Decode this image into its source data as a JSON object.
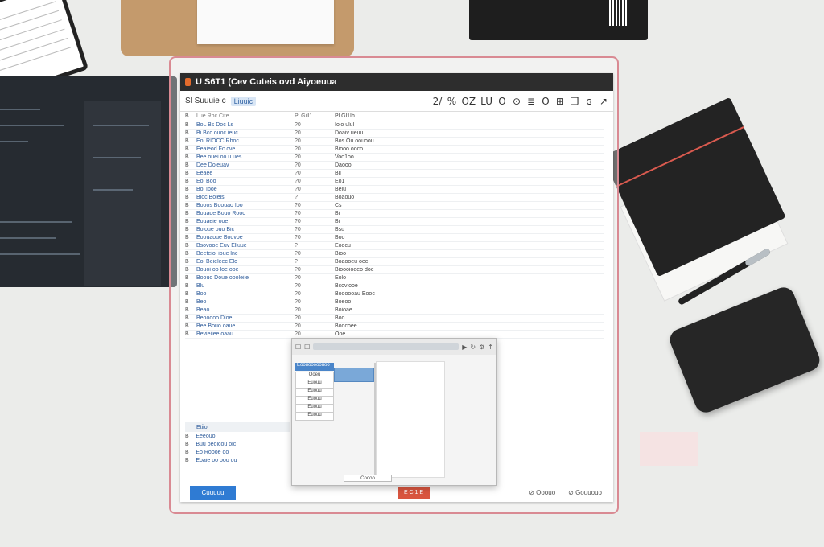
{
  "window": {
    "title": "U S6T1 (Cev Cuteis ovd Aiyoeuua",
    "toolbar": {
      "left_text": "Sl Suuuie c",
      "tag": "Liuuic",
      "icons": [
        "2/",
        "%",
        "OZ",
        "LU",
        "O",
        "⊙",
        "≣",
        "O",
        "⊞",
        "❒",
        "ɢ",
        "↗"
      ]
    },
    "table": {
      "headers": [
        "B",
        "Lue Rbc Cite",
        "Pl Gill1",
        "Pl Gl1Ih"
      ],
      "rows": [
        [
          "B",
          "BoL Bs Doc Ls",
          "?0",
          "Iolo ulul"
        ],
        [
          "B",
          "Bi Bcc ouoc ieuc",
          "?0",
          "Doaiv ueuu"
        ],
        [
          "B",
          "Eoi RIOCC Rboc",
          "?0",
          "Bos Ou oouoou"
        ],
        [
          "B",
          "Eeaieod Fc cve",
          "?0",
          "Biooo ooco"
        ],
        [
          "B",
          "Bee ouei oo u ues",
          "?0",
          "Voo1oo"
        ],
        [
          "B",
          "Dee Doieuav",
          "?0",
          "Daooo"
        ],
        [
          "B",
          "Eeaee",
          "?0",
          "Bli"
        ],
        [
          "B",
          "Eoi Boo",
          "?0",
          "Eo1"
        ],
        [
          "B",
          "Boi Iboe",
          "?0",
          "Beiu"
        ],
        [
          "B",
          "Bloc Bolels",
          "?",
          "Boaouo"
        ],
        [
          "B",
          "Booos Boouao Ioo",
          "?0",
          "Cs"
        ],
        [
          "B",
          "Bouaoe Bouo Rooo",
          "?0",
          "Bi"
        ],
        [
          "B",
          "Eouaeie ooe",
          "?0",
          "Bi"
        ],
        [
          "B",
          "Boioue ouo Bic",
          "?0",
          "Bsu"
        ],
        [
          "B",
          "Eoouaoue Boovoe",
          "?0",
          "Boo"
        ],
        [
          "B",
          "Bsovooe Euv Elluue",
          "?",
          "Eoocu"
        ],
        [
          "B",
          "Beeteioi ioue lnc",
          "?0",
          "Bioo"
        ],
        [
          "B",
          "Eoi Beieleec Elc",
          "?",
          "Boaooeu oec"
        ],
        [
          "B",
          "Bouoi oo loe ooe",
          "?0",
          "Bioooioeeo doe"
        ],
        [
          "B",
          "Boouo Doue oooleile",
          "?0",
          "Eolo"
        ],
        [
          "B",
          "Blu",
          "?0",
          "Bcoviooe"
        ],
        [
          "B",
          "Boo",
          "?0",
          "Boooooau Eooc"
        ],
        [
          "B",
          "Beo",
          "?0",
          "Boeoo"
        ],
        [
          "B",
          "Beao",
          "?0",
          "Boioae"
        ],
        [
          "B",
          "Beooooo Dloe",
          "?0",
          "Boo"
        ],
        [
          "B",
          "Bee Bouo oaue",
          "?0",
          "Boocoee"
        ],
        [
          "B",
          "Bevieiiee oaau",
          "?0",
          "Ooe"
        ]
      ]
    },
    "group2": {
      "header": "Etiio",
      "rows": [
        [
          "B",
          "Eeeouo"
        ],
        [
          "B",
          "Buu oeoicou olc"
        ],
        [
          "B",
          "Eo Roooe oo"
        ],
        [
          "B",
          "Eoaie oo ooo ou"
        ]
      ]
    },
    "statusbar": {
      "primary_button": "Cuuuuu",
      "danger_button": "E C 1 E",
      "right_items": [
        "⊘ Ooouo",
        "⊘ Gouuouo"
      ]
    },
    "dialog": {
      "icons": [
        "☐",
        "☐",
        "▶",
        "↻",
        "⚙",
        "↑"
      ],
      "selected_item": "Eoouooooouoo",
      "items": [
        "Ooeu",
        "Euouu",
        "Euouu",
        "Euouu",
        "Euouu",
        "Euouu"
      ],
      "button": "Coooo"
    }
  }
}
